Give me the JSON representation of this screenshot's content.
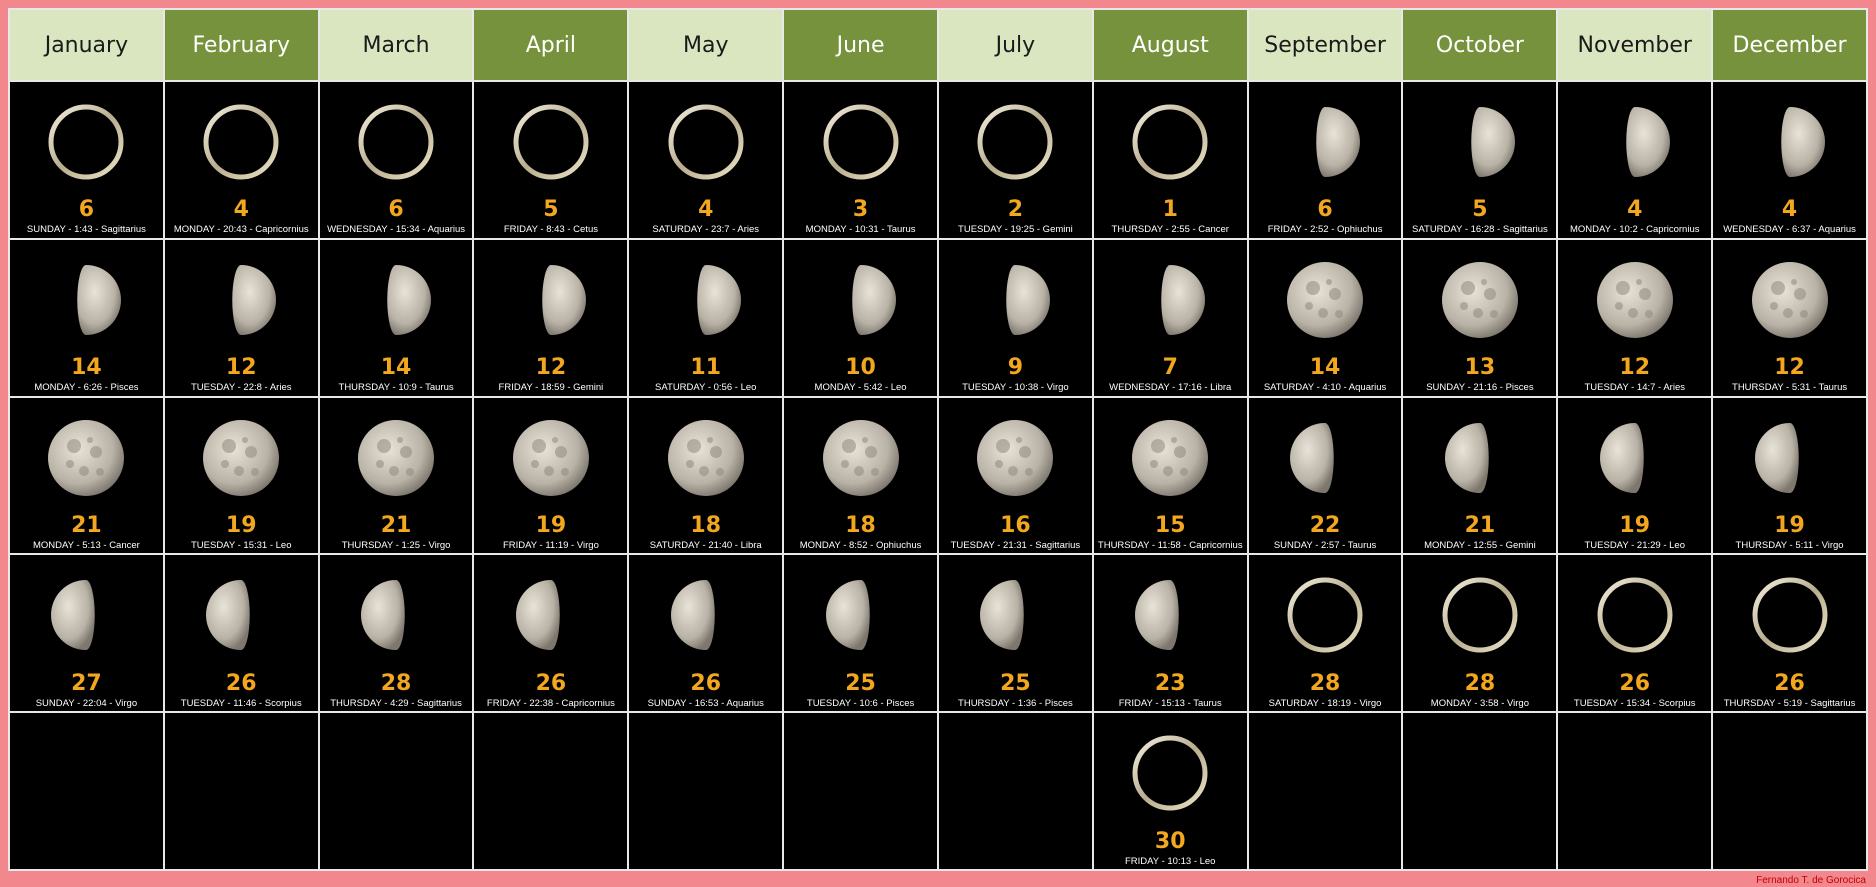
{
  "months": [
    {
      "name": "January",
      "style": "light"
    },
    {
      "name": "February",
      "style": "dark"
    },
    {
      "name": "March",
      "style": "light"
    },
    {
      "name": "April",
      "style": "dark"
    },
    {
      "name": "May",
      "style": "light"
    },
    {
      "name": "June",
      "style": "dark"
    },
    {
      "name": "July",
      "style": "light"
    },
    {
      "name": "August",
      "style": "dark"
    },
    {
      "name": "September",
      "style": "light"
    },
    {
      "name": "October",
      "style": "dark"
    },
    {
      "name": "November",
      "style": "light"
    },
    {
      "name": "December",
      "style": "dark"
    }
  ],
  "rows": [
    [
      {
        "phase": "new",
        "day": "6",
        "info": "SUNDAY  - 1:43 - Sagittarius"
      },
      {
        "phase": "new",
        "day": "4",
        "info": "MONDAY  - 20:43 - Capricornius"
      },
      {
        "phase": "new",
        "day": "6",
        "info": "WEDNESDAY  - 15:34 - Aquarius"
      },
      {
        "phase": "new",
        "day": "5",
        "info": "FRIDAY   - 8:43 - Cetus"
      },
      {
        "phase": "new",
        "day": "4",
        "info": "SATURDAY  - 23:7 - Aries"
      },
      {
        "phase": "new",
        "day": "3",
        "info": "MONDAY   - 10:31 - Taurus"
      },
      {
        "phase": "new",
        "day": "2",
        "info": "TUESDAY  - 19:25 - Gemini"
      },
      {
        "phase": "new",
        "day": "1",
        "info": "THURSDAY - 2:55 - Cancer"
      },
      {
        "phase": "first",
        "day": "6",
        "info": "FRIDAY - 2:52 - Ophiuchus"
      },
      {
        "phase": "first",
        "day": "5",
        "info": "SATURDAY  - 16:28 - Sagittarius"
      },
      {
        "phase": "first",
        "day": "4",
        "info": "MONDAY  - 10:2 - Capricornius"
      },
      {
        "phase": "first",
        "day": "4",
        "info": "WEDNESDAY  - 6:37 - Aquarius"
      }
    ],
    [
      {
        "phase": "first",
        "day": "14",
        "info": "MONDAY - 6:26 - Pisces"
      },
      {
        "phase": "first",
        "day": "12",
        "info": "TUESDAY  - 22:8 - Aries"
      },
      {
        "phase": "first",
        "day": "14",
        "info": "THURSDAY  - 10:9 - Taurus"
      },
      {
        "phase": "first",
        "day": "12",
        "info": "FRIDAY  - 18:59 - Gemini"
      },
      {
        "phase": "first",
        "day": "11",
        "info": "SATURDAY  - 0:56 - Leo"
      },
      {
        "phase": "first",
        "day": "10",
        "info": "MONDAY  - 5:42 - Leo"
      },
      {
        "phase": "first",
        "day": "9",
        "info": "TUESDAY  - 10:38 - Virgo"
      },
      {
        "phase": "first",
        "day": "7",
        "info": "WEDNESDAY  - 17:16 - Libra"
      },
      {
        "phase": "full",
        "day": "14",
        "info": "SATURDAY  - 4:10 - Aquarius"
      },
      {
        "phase": "full",
        "day": "13",
        "info": "SUNDAY  - 21:16 - Pisces"
      },
      {
        "phase": "full",
        "day": "12",
        "info": "TUESDAY  - 14:7 - Aries"
      },
      {
        "phase": "full",
        "day": "12",
        "info": "THURSDAY  - 5:31 - Taurus"
      }
    ],
    [
      {
        "phase": "full",
        "day": "21",
        "info": "MONDAY  - 5:13 - Cancer"
      },
      {
        "phase": "full",
        "day": "19",
        "info": "TUESDAY  - 15:31 - Leo"
      },
      {
        "phase": "full",
        "day": "21",
        "info": "THURSDAY - 1:25 - Virgo"
      },
      {
        "phase": "full",
        "day": "19",
        "info": "FRIDAY   - 11:19 - Virgo"
      },
      {
        "phase": "full",
        "day": "18",
        "info": "SATURDAY  - 21:40 - Libra"
      },
      {
        "phase": "full",
        "day": "18",
        "info": "MONDAY  - 8:52 - Ophiuchus"
      },
      {
        "phase": "full",
        "day": "16",
        "info": "TUESDAY  - 21:31 - Sagittarius"
      },
      {
        "phase": "full",
        "day": "15",
        "info": "THURSDAY  - 11:58 - Capricornius"
      },
      {
        "phase": "last",
        "day": "22",
        "info": "SUNDAY - 2:57 - Taurus"
      },
      {
        "phase": "last",
        "day": "21",
        "info": "MONDAY   - 12:55 - Gemini"
      },
      {
        "phase": "last",
        "day": "19",
        "info": "TUESDAY  - 21:29 - Leo"
      },
      {
        "phase": "last",
        "day": "19",
        "info": "THURSDAY  - 5:11 - Virgo"
      }
    ],
    [
      {
        "phase": "last",
        "day": "27",
        "info": "SUNDAY  - 22:04 - Virgo"
      },
      {
        "phase": "last",
        "day": "26",
        "info": "TUESDAY  - 11:46 - Scorpius"
      },
      {
        "phase": "last",
        "day": "28",
        "info": "THURSDAY  - 4:29 - Sagittarius"
      },
      {
        "phase": "last",
        "day": "26",
        "info": "FRIDAY  - 22:38 - Capricornius"
      },
      {
        "phase": "last",
        "day": "26",
        "info": "SUNDAY  - 16:53 - Aquarius"
      },
      {
        "phase": "last",
        "day": "25",
        "info": "TUESDAY  - 10:6 - Pisces"
      },
      {
        "phase": "last",
        "day": "25",
        "info": "THURSDAY - 1:36 - Pisces"
      },
      {
        "phase": "last",
        "day": "23",
        "info": "FRIDAY  - 15:13 - Taurus"
      },
      {
        "phase": "new",
        "day": "28",
        "info": "SATURDAY  - 18:19 - Virgo"
      },
      {
        "phase": "new",
        "day": "28",
        "info": "MONDAY  - 3:58 - Virgo"
      },
      {
        "phase": "new",
        "day": "26",
        "info": "TUESDAY  - 15:34 - Scorpius"
      },
      {
        "phase": "new",
        "day": "26",
        "info": "THURSDAY  - 5:19 - Sagittarius"
      }
    ],
    [
      null,
      null,
      null,
      null,
      null,
      null,
      null,
      {
        "phase": "new",
        "day": "30",
        "info": "FRIDAY  - 10:13 - Leo"
      },
      null,
      null,
      null,
      null
    ]
  ],
  "credit": "Fernando T. de Gorocica",
  "colors": {
    "background": "#f2878e",
    "header_light": "#d9e6bf",
    "header_dark": "#77923c",
    "day_number": "#f2a71e",
    "credit": "#c00000"
  }
}
